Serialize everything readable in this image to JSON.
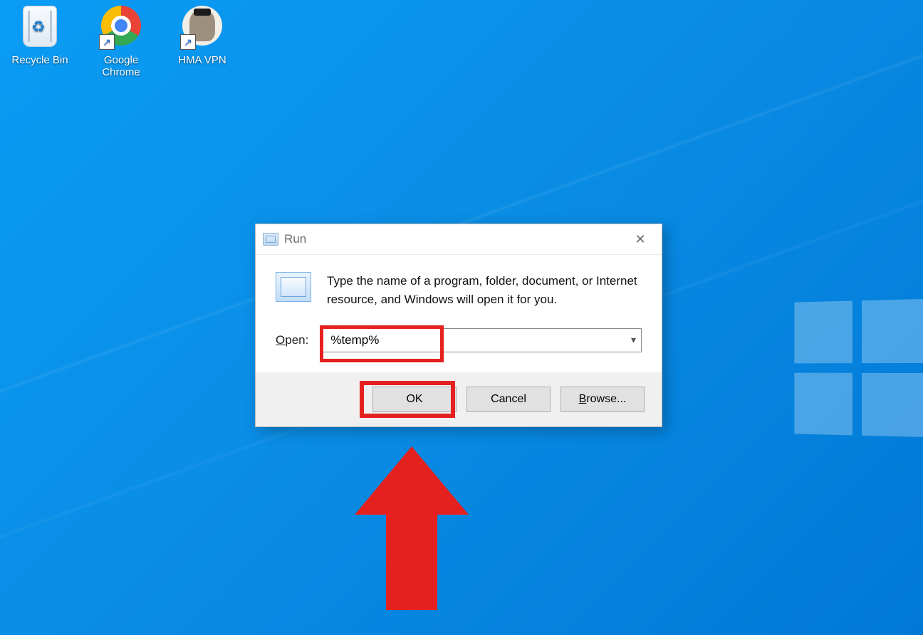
{
  "desktop_icons": {
    "recycle_bin": "Recycle Bin",
    "chrome": "Google Chrome",
    "hma": "HMA VPN"
  },
  "dialog": {
    "title": "Run",
    "description": "Type the name of a program, folder, document, or Internet resource, and Windows will open it for you.",
    "open_label_prefix": "O",
    "open_label_rest": "pen:",
    "input_value": "%temp%",
    "buttons": {
      "ok": "OK",
      "cancel": "Cancel",
      "browse_prefix": "B",
      "browse_rest": "rowse..."
    }
  },
  "annotation": {
    "highlight_color": "#e5211f"
  }
}
